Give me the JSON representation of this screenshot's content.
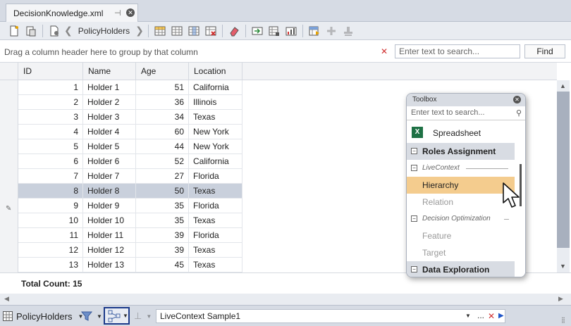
{
  "document_tab": {
    "title": "DecisionKnowledge.xml"
  },
  "toolbar": {
    "nav_label": "PolicyHolders"
  },
  "groupbar": {
    "hint": "Drag a column header here to group by that column",
    "search_placeholder": "Enter text to search...",
    "find_label": "Find"
  },
  "grid": {
    "columns": [
      "ID",
      "Name",
      "Age",
      "Location"
    ],
    "rows": [
      {
        "id": "1",
        "name": "Holder 1",
        "age": "51",
        "location": "California"
      },
      {
        "id": "2",
        "name": "Holder 2",
        "age": "36",
        "location": "Illinois"
      },
      {
        "id": "3",
        "name": "Holder 3",
        "age": "34",
        "location": "Texas"
      },
      {
        "id": "4",
        "name": "Holder 4",
        "age": "60",
        "location": "New York"
      },
      {
        "id": "5",
        "name": "Holder 5",
        "age": "44",
        "location": "New York"
      },
      {
        "id": "6",
        "name": "Holder 6",
        "age": "52",
        "location": "California"
      },
      {
        "id": "7",
        "name": "Holder 7",
        "age": "27",
        "location": "Florida"
      },
      {
        "id": "8",
        "name": "Holder 8",
        "age": "50",
        "location": "Texas"
      },
      {
        "id": "9",
        "name": "Holder 9",
        "age": "35",
        "location": "Florida"
      },
      {
        "id": "10",
        "name": "Holder 10",
        "age": "35",
        "location": "Texas"
      },
      {
        "id": "11",
        "name": "Holder 11",
        "age": "39",
        "location": "Florida"
      },
      {
        "id": "12",
        "name": "Holder 12",
        "age": "39",
        "location": "Texas"
      },
      {
        "id": "13",
        "name": "Holder 13",
        "age": "45",
        "location": "Texas"
      }
    ],
    "selected_row_id": "8",
    "total_count": "Total Count: 15"
  },
  "toolbox": {
    "title": "Toolbox",
    "search_placeholder": "Enter text to search...",
    "items": {
      "spreadsheet": "Spreadsheet",
      "roles_assignment": "Roles Assignment",
      "livecontext": "LiveContext",
      "hierarchy": "Hierarchy",
      "relation": "Relation",
      "decision_optimization": "Decision Optimization",
      "feature": "Feature",
      "target": "Target",
      "data_exploration": "Data Exploration"
    },
    "highlight_color": "#f4cc8e"
  },
  "statusbar": {
    "source_label": "PolicyHolders",
    "context_value": "LiveContext Sample1",
    "dots_label": "..."
  }
}
